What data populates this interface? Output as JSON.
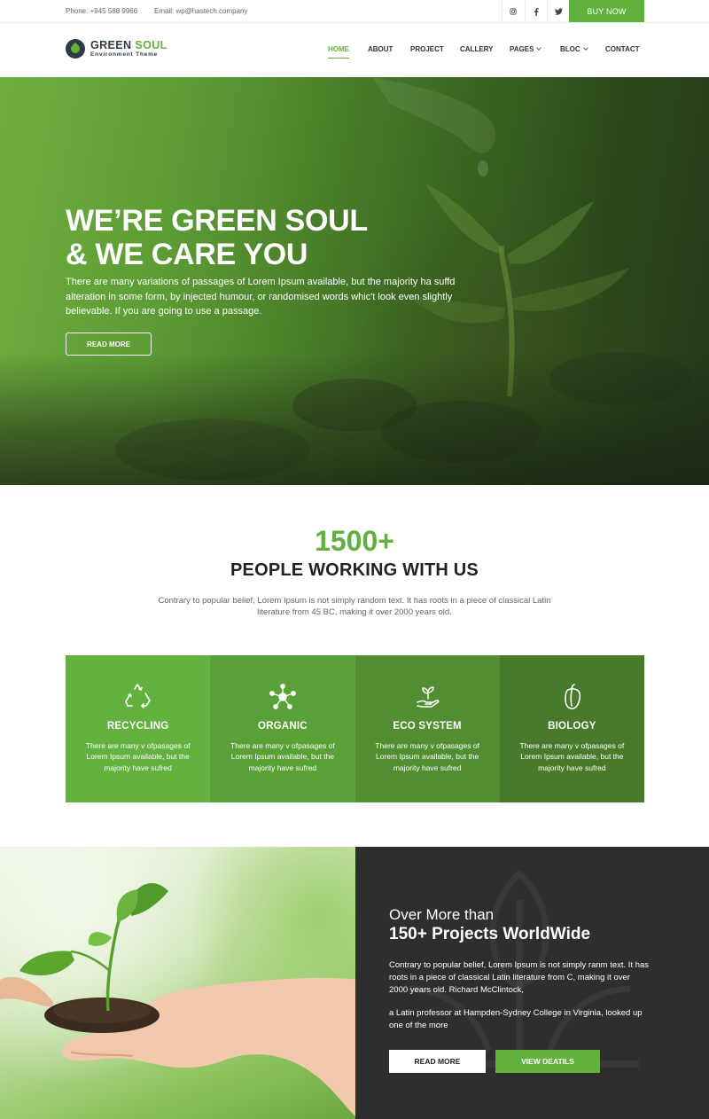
{
  "topbar": {
    "phone": "Phone: +945 588 9966",
    "email": "Email: wp@hastech.company",
    "socials": [
      "instagram-icon",
      "facebook-icon",
      "twitter-icon"
    ],
    "buy_now": "BUY NOW"
  },
  "header": {
    "logo_name_1": "GREEN",
    "logo_name_2": "SOUL",
    "logo_tagline": "Environment Theme",
    "nav": [
      {
        "label": "HOME",
        "active": true
      },
      {
        "label": "ABOUT"
      },
      {
        "label": "PROJECT"
      },
      {
        "label": "CALLERY"
      },
      {
        "label": "PAGES",
        "dropdown": true
      },
      {
        "label": "BLOC",
        "dropdown": true
      },
      {
        "label": "CONTACT"
      }
    ]
  },
  "hero": {
    "title_line1": "WE’RE GREEN SOUL",
    "title_line2": "& WE CARE YOU",
    "text": "There are many variations of passages of Lorem Ipsum available, but the majority ha suffd alteration in some form, by injected humour, or randomised words whic't look even slightly believable. If you are going to use a passage.",
    "button": "READ MORE"
  },
  "stats": {
    "number": "1500+",
    "title": "PEOPLE WORKING WITH US",
    "description": "Contrary to popular belief, Lorem Ipsum is not simply random text. It has roots in a piece of classical Latin literature from 45 BC, making it over 2000 years old."
  },
  "features": [
    {
      "icon": "recycle-icon",
      "title": "RECYCLING",
      "text": "There are many v ofpasages of Lorem Ipsum available, but the majority have sufred",
      "color": "#63b13f"
    },
    {
      "icon": "molecule-icon",
      "title": "ORGANIC",
      "text": "There are many v ofpasages of Lorem Ipsum available, but the majority have sufred",
      "color": "#59a136"
    },
    {
      "icon": "plant-hand-icon",
      "title": "ECO SYSTEM",
      "text": "There are many v ofpasages of Lorem Ipsum available, but the majority have sufred",
      "color": "#528e31"
    },
    {
      "icon": "pepper-icon",
      "title": "BIOLOGY",
      "text": "There are many v ofpasages of Lorem Ipsum available, but the majority have sufred",
      "color": "#477b2b"
    }
  ],
  "projects": {
    "subtitle": "Over More than",
    "title": "150+ Projects WorldWide",
    "paragraph1": "Contrary to popular belief, Lorem Ipsum is not simply ranm text. It has roots in a piece of classical Latin literature from C, making it over 2000 years old. Richard McClintock,",
    "paragraph2": "a Latin professor at Hampden-Sydney College in Virginia, looked up one of the more",
    "button_read": "READ MORE",
    "button_view": "VIEW DEATILS"
  },
  "colors": {
    "accent": "#62b13f",
    "dark_panel": "#2e2e2e",
    "logo_dark": "#2e3b44"
  }
}
